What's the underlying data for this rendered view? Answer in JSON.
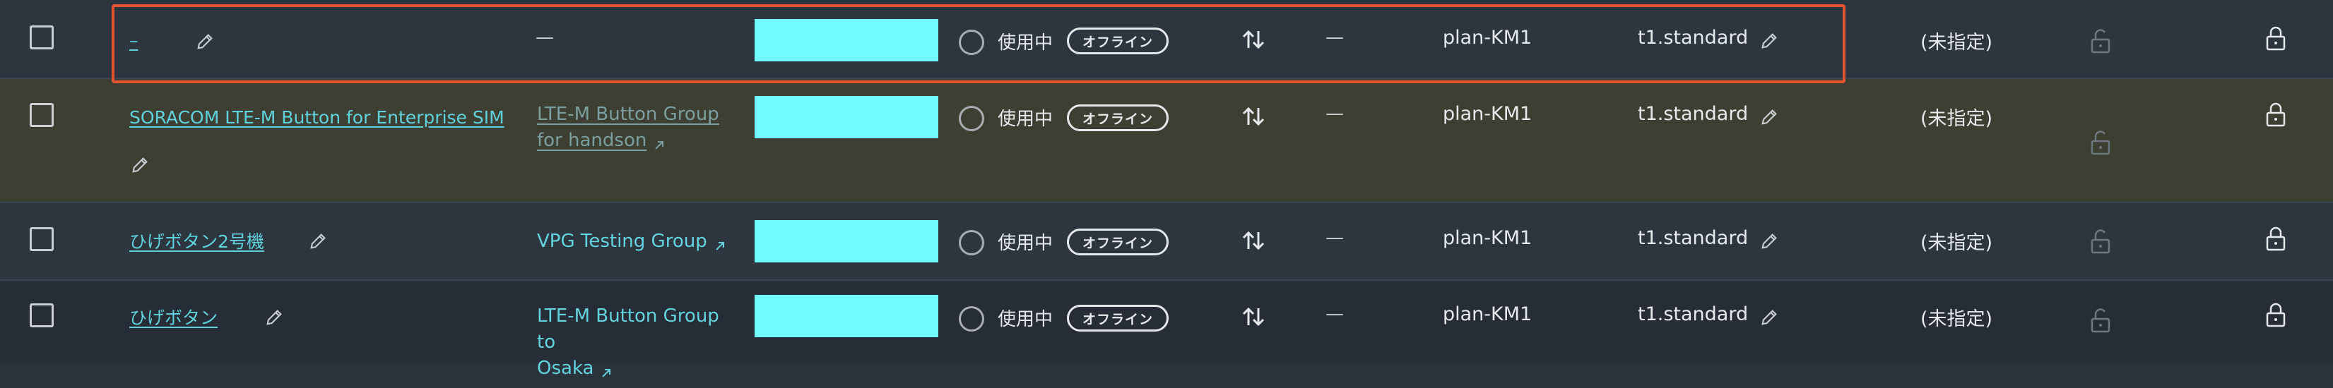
{
  "colors": {
    "accent_link": "#5fd2dc",
    "highlight_border": "#e5522f",
    "sim_cell": "#72fbfd"
  },
  "rows": [
    {
      "name": "–",
      "group": "—",
      "status": "使用中",
      "badge": "オフライン",
      "dash": "—",
      "plan": "plan-KM1",
      "type": "t1.standard",
      "unspecified": "(未指定)"
    },
    {
      "name": "SORACOM LTE-M Button for Enterprise SIM",
      "group_line1": "LTE-M Button Group",
      "group_line2": "for handson",
      "status": "使用中",
      "badge": "オフライン",
      "dash": "—",
      "plan": "plan-KM1",
      "type": "t1.standard",
      "unspecified": "(未指定)"
    },
    {
      "name": "ひげボタン2号機",
      "group": "VPG Testing Group",
      "status": "使用中",
      "badge": "オフライン",
      "dash": "—",
      "plan": "plan-KM1",
      "type": "t1.standard",
      "unspecified": "(未指定)"
    },
    {
      "name": "ひげボタン",
      "group_line1": "LTE-M Button Group to",
      "group_line2": "Osaka",
      "status": "使用中",
      "badge": "オフライン",
      "dash": "—",
      "plan": "plan-KM1",
      "type": "t1.standard",
      "unspecified": "(未指定)"
    }
  ]
}
